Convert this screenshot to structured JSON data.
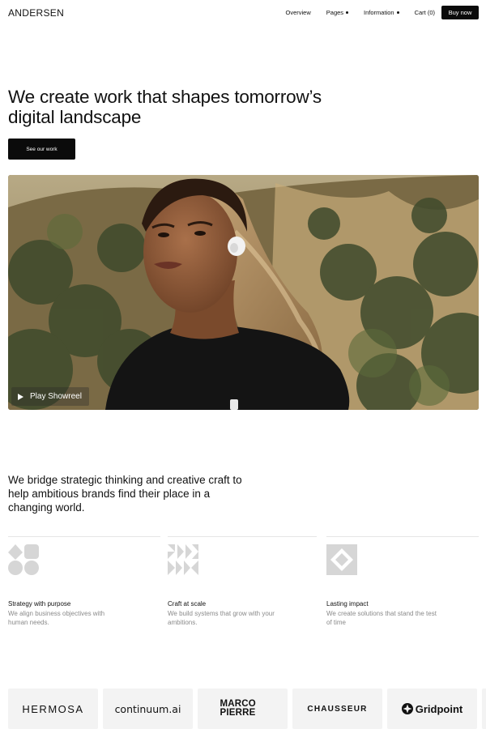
{
  "brand": {
    "logo": "ANDERSEN"
  },
  "nav": {
    "items": [
      {
        "label": "Overview",
        "dropdown": false
      },
      {
        "label": "Pages",
        "dropdown": true
      },
      {
        "label": "Information",
        "dropdown": true
      },
      {
        "label": "Cart (0)",
        "dropdown": false
      }
    ],
    "cta": "Buy now"
  },
  "hero": {
    "title": "We create work that shapes tomorrow’s digital landscape",
    "button": "See our work",
    "play_label": "Play Showreel"
  },
  "statement": "We bridge strategic thinking and creative craft to help ambitious brands find their place in a changing world.",
  "features": [
    {
      "title": "Strategy with purpose",
      "description": "We align business objectives with human needs.",
      "icon": "shapes-icon"
    },
    {
      "title": "Craft at scale",
      "description": "We build systems that grow with your ambitions.",
      "icon": "arrows-grid-icon"
    },
    {
      "title": "Lasting impact",
      "description": "We create solutions that stand the test of time",
      "icon": "diamond-square-icon"
    }
  ],
  "client_logos": [
    "HERMOSA",
    "continuum.ai",
    "MARCO PIERRE",
    "CHAUSSEUR",
    "Gridpoint"
  ],
  "colors": {
    "primary": "#0b0b0b",
    "text": "#111111",
    "muted": "#8a8a8a",
    "card": "#f3f3f3",
    "icon_gray": "#d6d6d6"
  }
}
